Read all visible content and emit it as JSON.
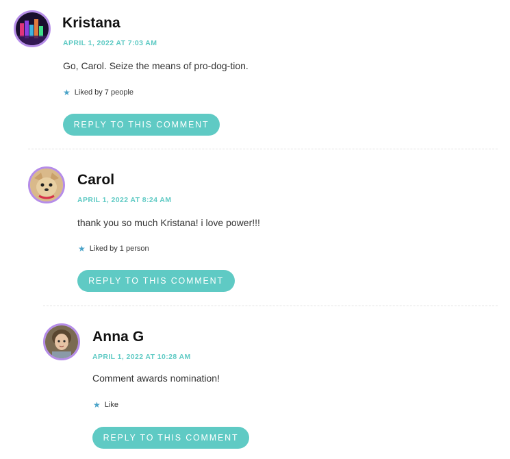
{
  "comments": [
    {
      "author": "Kristana",
      "date": "APRIL 1, 2022 AT 7:03 AM",
      "text": "Go, Carol. Seize the means of pro-dog-tion.",
      "likes": "Liked by 7 people",
      "reply_label": "REPLY TO THIS COMMENT"
    },
    {
      "author": "Carol",
      "date": "APRIL 1, 2022 AT 8:24 AM",
      "text": "thank you so much Kristana! i love power!!!",
      "likes": "Liked by 1 person",
      "reply_label": "REPLY TO THIS COMMENT"
    },
    {
      "author": "Anna G",
      "date": "APRIL 1, 2022 AT 10:28 AM",
      "text": "Comment awards nomination!",
      "likes": "Like",
      "reply_label": "REPLY TO THIS COMMENT"
    }
  ],
  "icons": {
    "like": "star-icon"
  },
  "colors": {
    "accent": "#5fcac4",
    "avatar_ring": "#b58ce8",
    "star": "#4aa3c8"
  }
}
